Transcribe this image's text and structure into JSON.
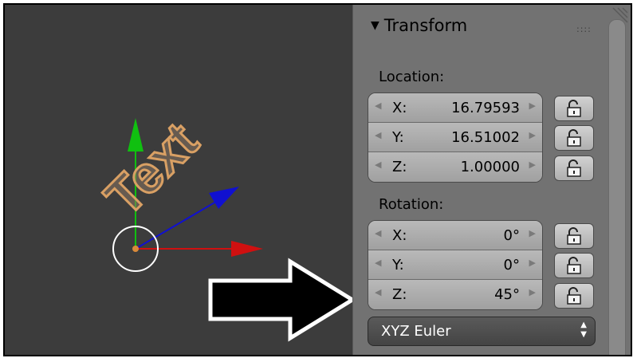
{
  "viewport": {
    "object_text": "Text"
  },
  "panel": {
    "title": "Transform",
    "grip": "::::",
    "location": {
      "label": "Location:",
      "fields": [
        {
          "axis": "X:",
          "value": "16.79593"
        },
        {
          "axis": "Y:",
          "value": "16.51002"
        },
        {
          "axis": "Z:",
          "value": "1.00000"
        }
      ]
    },
    "rotation": {
      "label": "Rotation:",
      "fields": [
        {
          "axis": "X:",
          "value": "0°"
        },
        {
          "axis": "Y:",
          "value": "0°"
        },
        {
          "axis": "Z:",
          "value": "45°"
        }
      ]
    },
    "rotation_mode": "XYZ Euler"
  },
  "colors": {
    "viewport_bg": "#3c3c3c",
    "panel_bg": "#727272",
    "axis_x": "#d01010",
    "axis_y": "#10c010",
    "axis_z": "#1010d0",
    "text_object": "#b08a60"
  },
  "icons": [
    "triangle-down-icon",
    "lock-icon",
    "arrow-left-icon",
    "arrow-right-icon",
    "up-down-caret-icon",
    "callout-arrow-icon"
  ]
}
